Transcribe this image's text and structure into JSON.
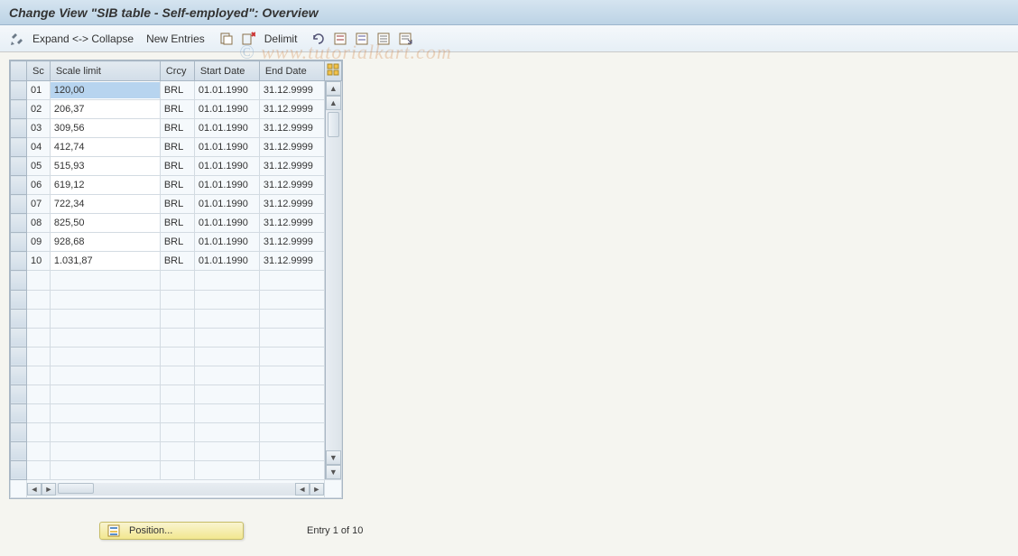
{
  "title": "Change View \"SIB table - Self-employed\": Overview",
  "toolbar": {
    "expand_collapse": "Expand <-> Collapse",
    "new_entries": "New Entries",
    "delimit": "Delimit"
  },
  "columns": {
    "sc": "Sc",
    "scale_limit": "Scale limit",
    "crcy": "Crcy",
    "start_date": "Start Date",
    "end_date": "End Date"
  },
  "rows": [
    {
      "sc": "01",
      "scale_limit": "120,00",
      "crcy": "BRL",
      "start": "01.01.1990",
      "end": "31.12.9999"
    },
    {
      "sc": "02",
      "scale_limit": "206,37",
      "crcy": "BRL",
      "start": "01.01.1990",
      "end": "31.12.9999"
    },
    {
      "sc": "03",
      "scale_limit": "309,56",
      "crcy": "BRL",
      "start": "01.01.1990",
      "end": "31.12.9999"
    },
    {
      "sc": "04",
      "scale_limit": "412,74",
      "crcy": "BRL",
      "start": "01.01.1990",
      "end": "31.12.9999"
    },
    {
      "sc": "05",
      "scale_limit": "515,93",
      "crcy": "BRL",
      "start": "01.01.1990",
      "end": "31.12.9999"
    },
    {
      "sc": "06",
      "scale_limit": "619,12",
      "crcy": "BRL",
      "start": "01.01.1990",
      "end": "31.12.9999"
    },
    {
      "sc": "07",
      "scale_limit": "722,34",
      "crcy": "BRL",
      "start": "01.01.1990",
      "end": "31.12.9999"
    },
    {
      "sc": "08",
      "scale_limit": "825,50",
      "crcy": "BRL",
      "start": "01.01.1990",
      "end": "31.12.9999"
    },
    {
      "sc": "09",
      "scale_limit": "928,68",
      "crcy": "BRL",
      "start": "01.01.1990",
      "end": "31.12.9999"
    },
    {
      "sc": "10",
      "scale_limit": "1.031,87",
      "crcy": "BRL",
      "start": "01.01.1990",
      "end": "31.12.9999"
    }
  ],
  "empty_rows": 11,
  "footer": {
    "position_btn": "Position...",
    "entry_text": "Entry 1 of 10"
  },
  "watermark": "www.tutorialkart.com"
}
